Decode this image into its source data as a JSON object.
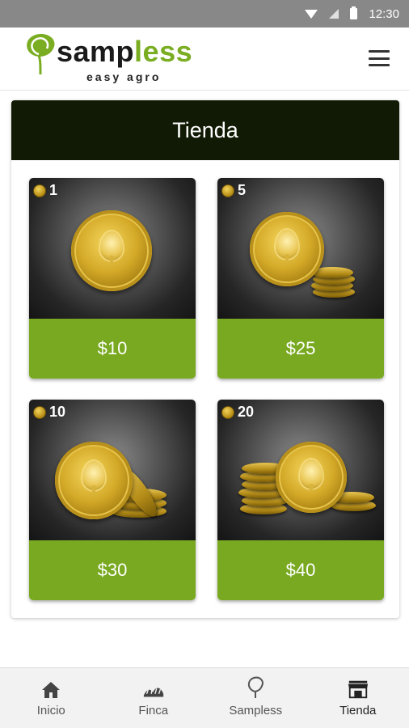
{
  "status_bar": {
    "time": "12:30"
  },
  "header": {
    "logo_word_part1": "samp",
    "logo_word_part2": "less",
    "logo_tagline": "easy agro",
    "menu_icon": "hamburger-menu-icon"
  },
  "store": {
    "title": "Tienda",
    "products": [
      {
        "coins": "1",
        "price": "$10"
      },
      {
        "coins": "5",
        "price": "$25"
      },
      {
        "coins": "10",
        "price": "$30"
      },
      {
        "coins": "20",
        "price": "$40"
      }
    ]
  },
  "bottom_nav": {
    "items": [
      {
        "label": "Inicio",
        "icon": "home-icon"
      },
      {
        "label": "Finca",
        "icon": "farm-icon"
      },
      {
        "label": "Sampless",
        "icon": "sampless-leaf-icon"
      },
      {
        "label": "Tienda",
        "icon": "store-icon"
      }
    ],
    "active": "Tienda"
  },
  "colors": {
    "brand_green": "#78a920",
    "title_bar_dark": "#111a04",
    "status_bar": "#888888"
  }
}
